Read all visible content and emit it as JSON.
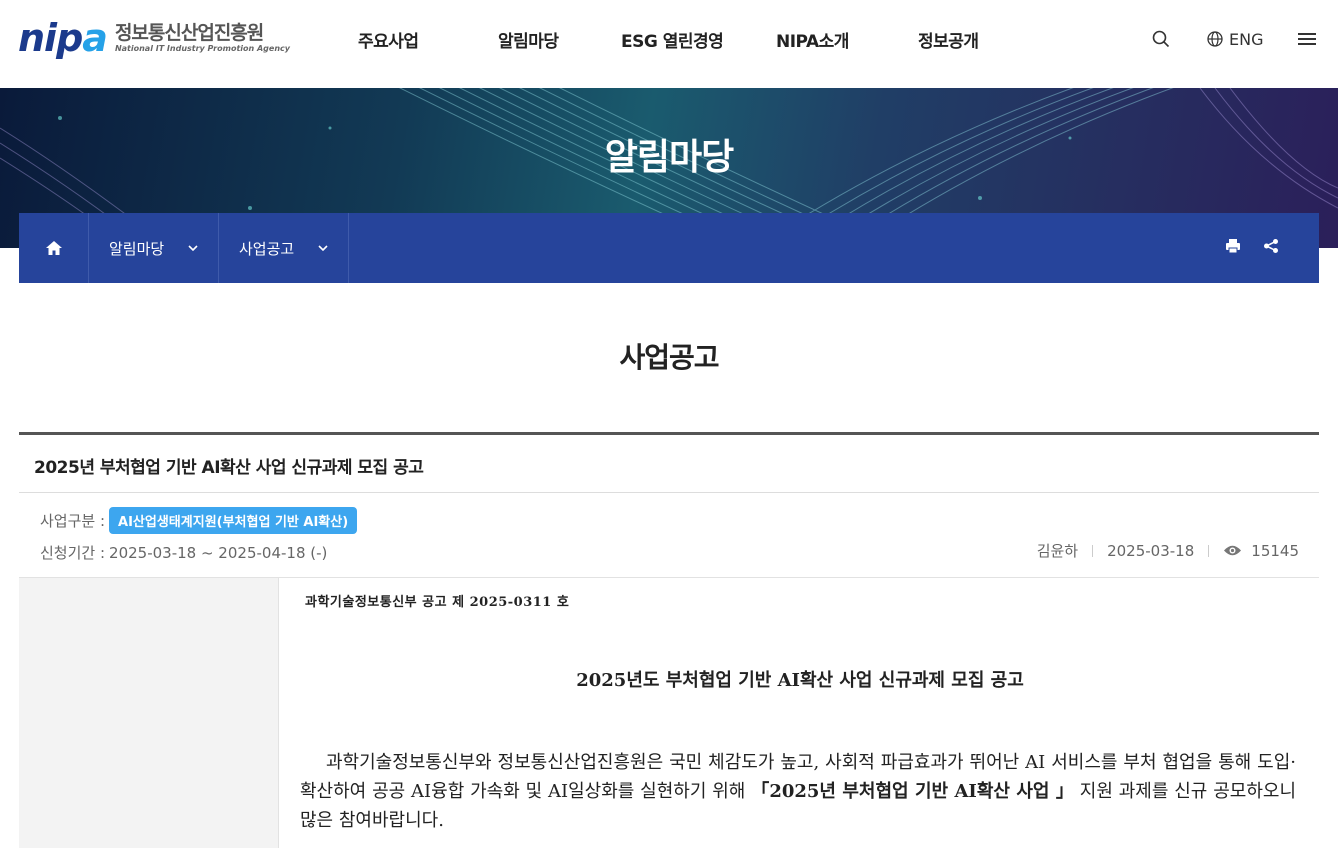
{
  "header": {
    "logo_mark_a": "nip",
    "logo_mark_b": "a",
    "logo_ko": "정보통신산업진흥원",
    "logo_en": "National IT Industry Promotion Agency",
    "nav": [
      "주요사업",
      "알림마당",
      "ESG 열린경영",
      "NIPA소개",
      "정보공개"
    ],
    "lang_label": "ENG"
  },
  "banner": {
    "title": "알림마당"
  },
  "location": {
    "dd1_label": "알림마당",
    "dd2_label": "사업공고"
  },
  "page_title": "사업공고",
  "post": {
    "title": "2025년 부처협업 기반 AI확산 사업 신규과제 모집 공고",
    "category_label": "사업구분 :",
    "category_value": "AI산업생태계지원(부처협업 기반 AI확산)",
    "period_label": "신청기간 :",
    "period_value": "2025-03-18 ~ 2025-04-18 (-)",
    "author": "김윤하",
    "date": "2025-03-18",
    "views": "15145"
  },
  "document": {
    "doc_no": "과학기술정보통신부 공고 제 2025-0311 호",
    "title": "2025년도 부처협업 기반 AI확산 사업 신규과제 모집 공고",
    "body_pre": "과학기술정보통신부와 정보통신산업진흥원은 국민 체감도가 높고, 사회적 파급효과가 뛰어난 AI 서비스를 부처 협업을 통해 도입·확산하여 공공 AI융합 가속화 및 AI일상화를 실현하기 위해 ",
    "body_bold": "「2025년 부처협업 기반 AI확산 사업 」",
    "body_post": " 지원 과제를 신규 공모하오니 많은 참여바랍니다."
  },
  "colors": {
    "brand_navy": "#1b3a8c",
    "brand_sky": "#25a1e8",
    "location_bar": "#26449b",
    "badge": "#3da6ef"
  },
  "icons": [
    "search-icon",
    "globe-icon",
    "hamburger-icon",
    "home-icon",
    "chevron-down-icon",
    "print-icon",
    "share-icon",
    "eye-icon"
  ]
}
